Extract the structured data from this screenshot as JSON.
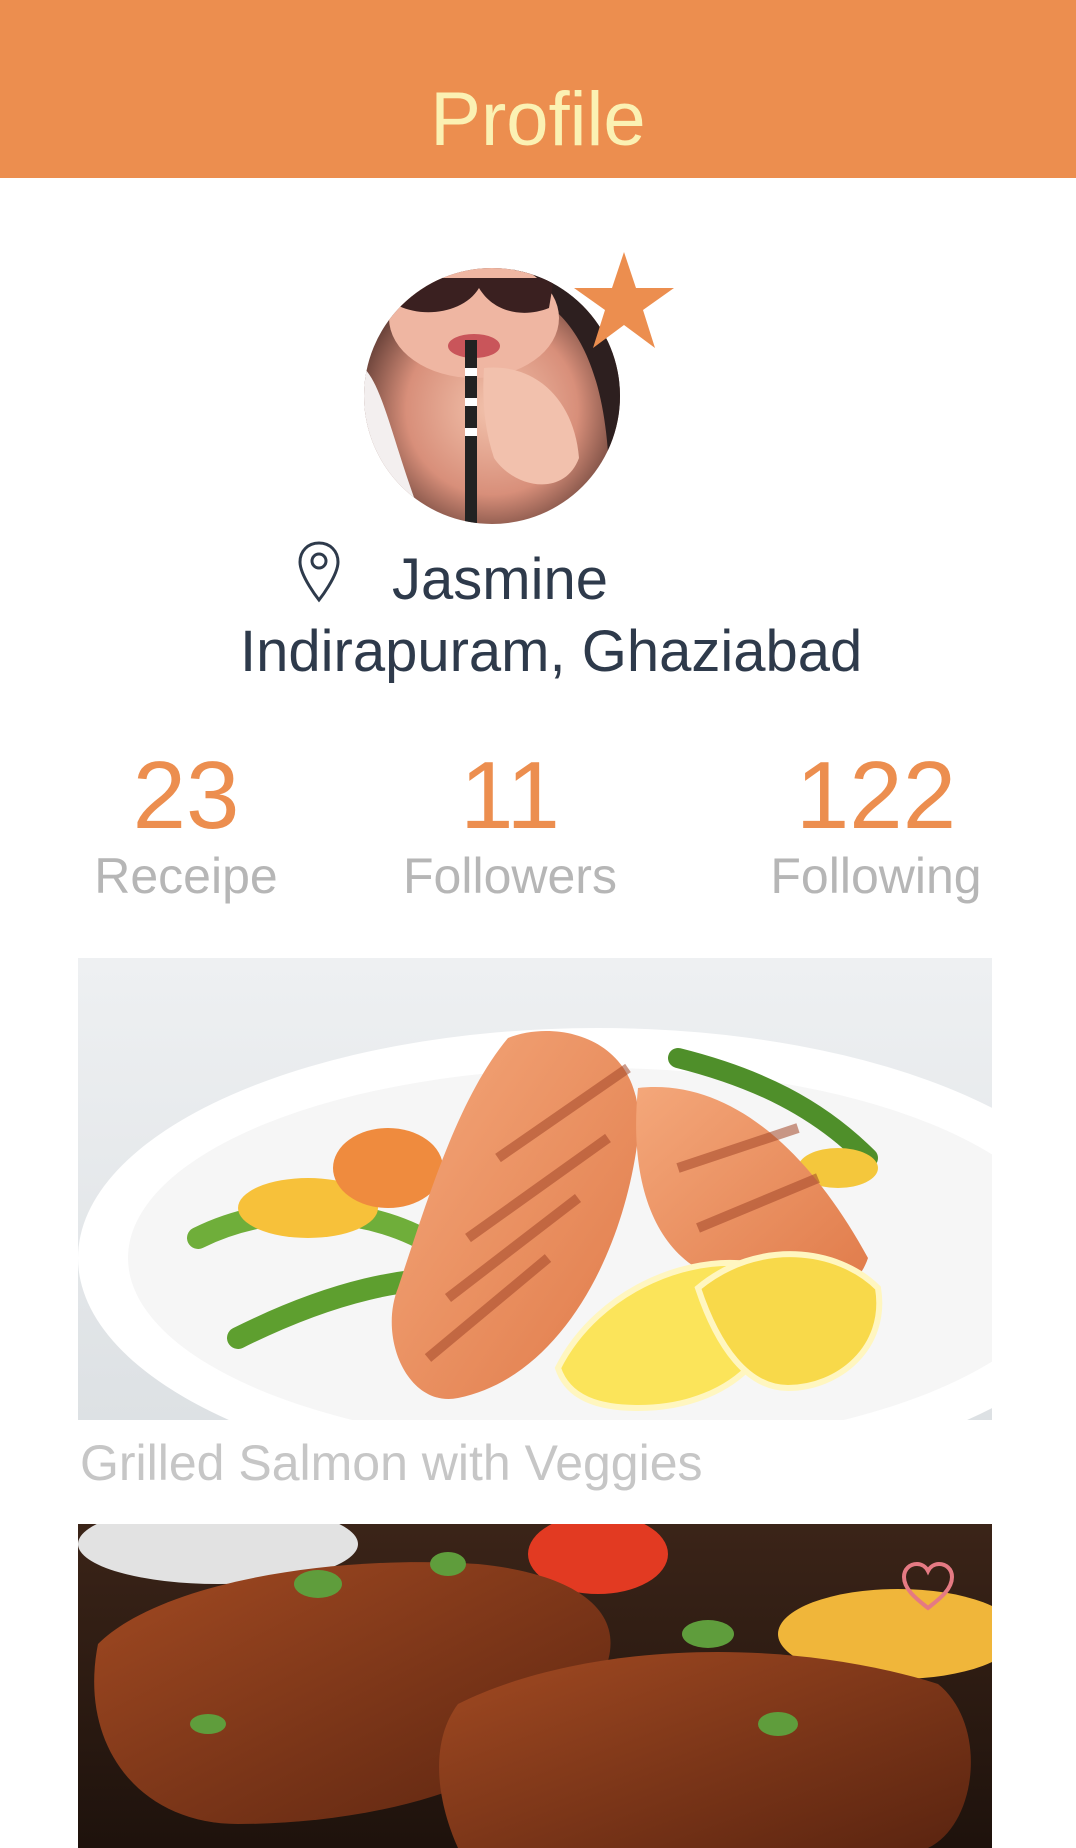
{
  "header": {
    "title": "Profile"
  },
  "profile": {
    "name": "Jasmine",
    "location": "Indirapuram, Ghaziabad"
  },
  "stats": [
    {
      "value": "23",
      "label": "Receipe"
    },
    {
      "value": "11",
      "label": "Followers"
    },
    {
      "value": "122",
      "label": "Following"
    }
  ],
  "recipes": [
    {
      "title": "Grilled Salmon with Veggies"
    }
  ],
  "icons": {
    "star": "star-icon",
    "pin": "location-pin-icon",
    "heart": "heart-icon"
  },
  "colors": {
    "accent": "#ec8e4f",
    "header_text": "#fbf1b3",
    "name_text": "#2e3a4b",
    "label_gray": "#b6b6b6"
  }
}
